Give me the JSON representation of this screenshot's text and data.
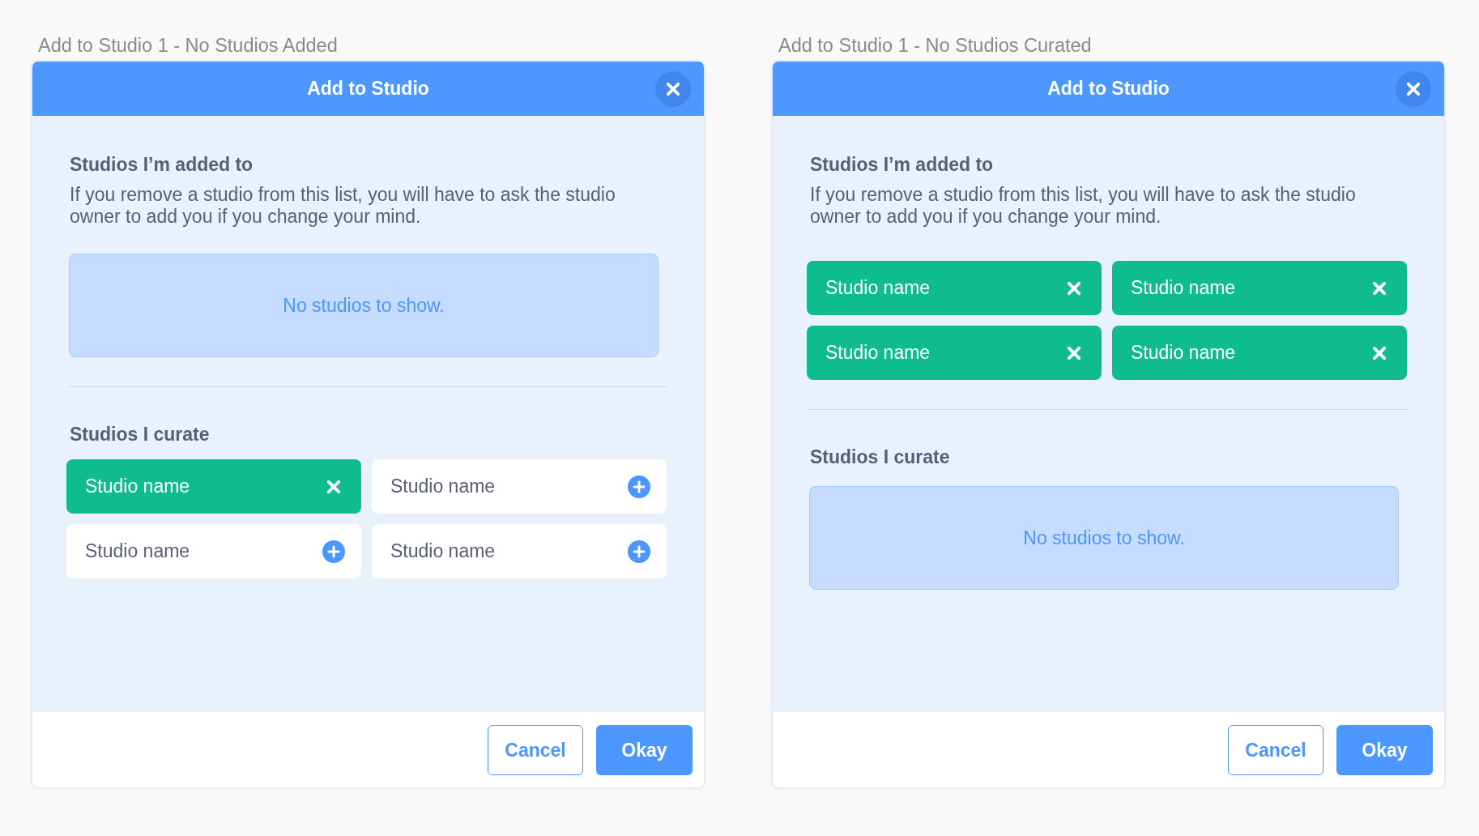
{
  "panels": [
    {
      "caption": "Add to Studio 1 - No Studios Added",
      "title": "Add to Studio",
      "sections": [
        {
          "heading": "Studios I’m added to",
          "description": "If you remove a studio from this list, you will have to ask the studio owner to add you if you change your mind.",
          "empty_message": "No studios to show."
        },
        {
          "heading": "Studios I curate",
          "studios": [
            {
              "name": "Studio name",
              "selected": true
            },
            {
              "name": "Studio name",
              "selected": false
            },
            {
              "name": "Studio name",
              "selected": false
            },
            {
              "name": "Studio name",
              "selected": false
            }
          ]
        }
      ],
      "buttons": [
        {
          "label": "Cancel",
          "kind": "secondary"
        },
        {
          "label": "Okay",
          "kind": "primary"
        }
      ]
    },
    {
      "caption": "Add to Studio 1 - No Studios Curated",
      "title": "Add to Studio",
      "sections": [
        {
          "heading": "Studios I’m added to",
          "description": "If you remove a studio from this list, you will have to ask the studio owner to add you if you change your mind.",
          "studios": [
            {
              "name": "Studio name",
              "selected": true
            },
            {
              "name": "Studio name",
              "selected": true
            },
            {
              "name": "Studio name",
              "selected": true
            },
            {
              "name": "Studio name",
              "selected": true
            }
          ]
        },
        {
          "heading": "Studios I curate",
          "empty_message": "No studios to show."
        }
      ],
      "buttons": [
        {
          "label": "Cancel",
          "kind": "secondary"
        },
        {
          "label": "Okay",
          "kind": "primary"
        }
      ]
    }
  ]
}
